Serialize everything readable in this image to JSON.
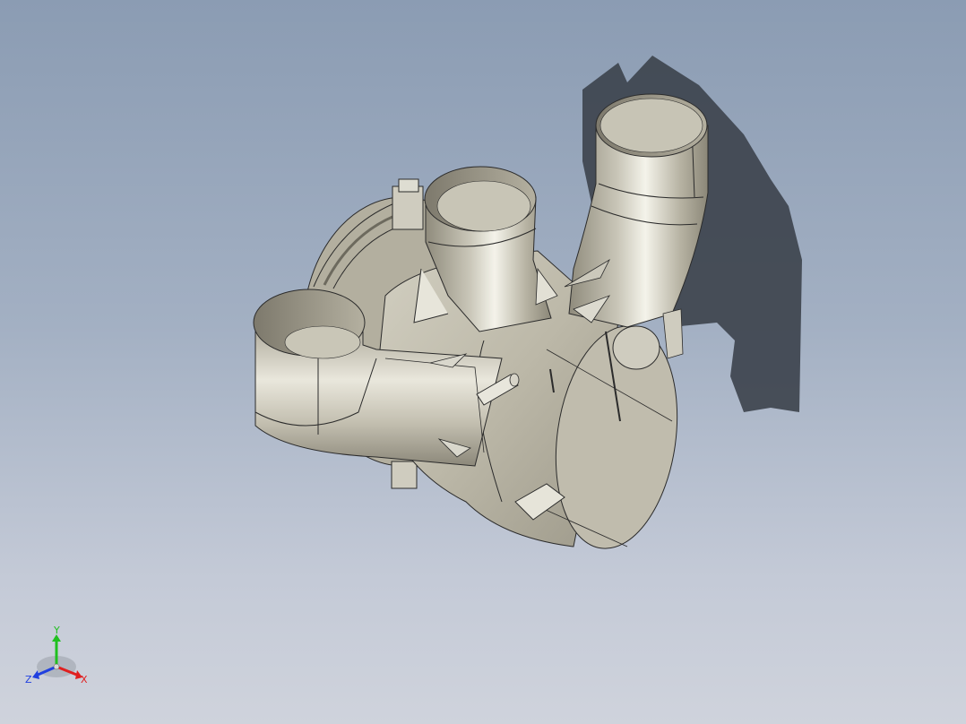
{
  "viewport": {
    "background_top": "#8b9cb3",
    "background_bottom": "#cfd3dc",
    "model_color": "#bcb9a9",
    "shadow_color": "#3e444e"
  },
  "triad": {
    "x_label": "X",
    "y_label": "Y",
    "z_label": "Z",
    "x_color": "#e02020",
    "y_color": "#20c020",
    "z_color": "#2040e0"
  }
}
